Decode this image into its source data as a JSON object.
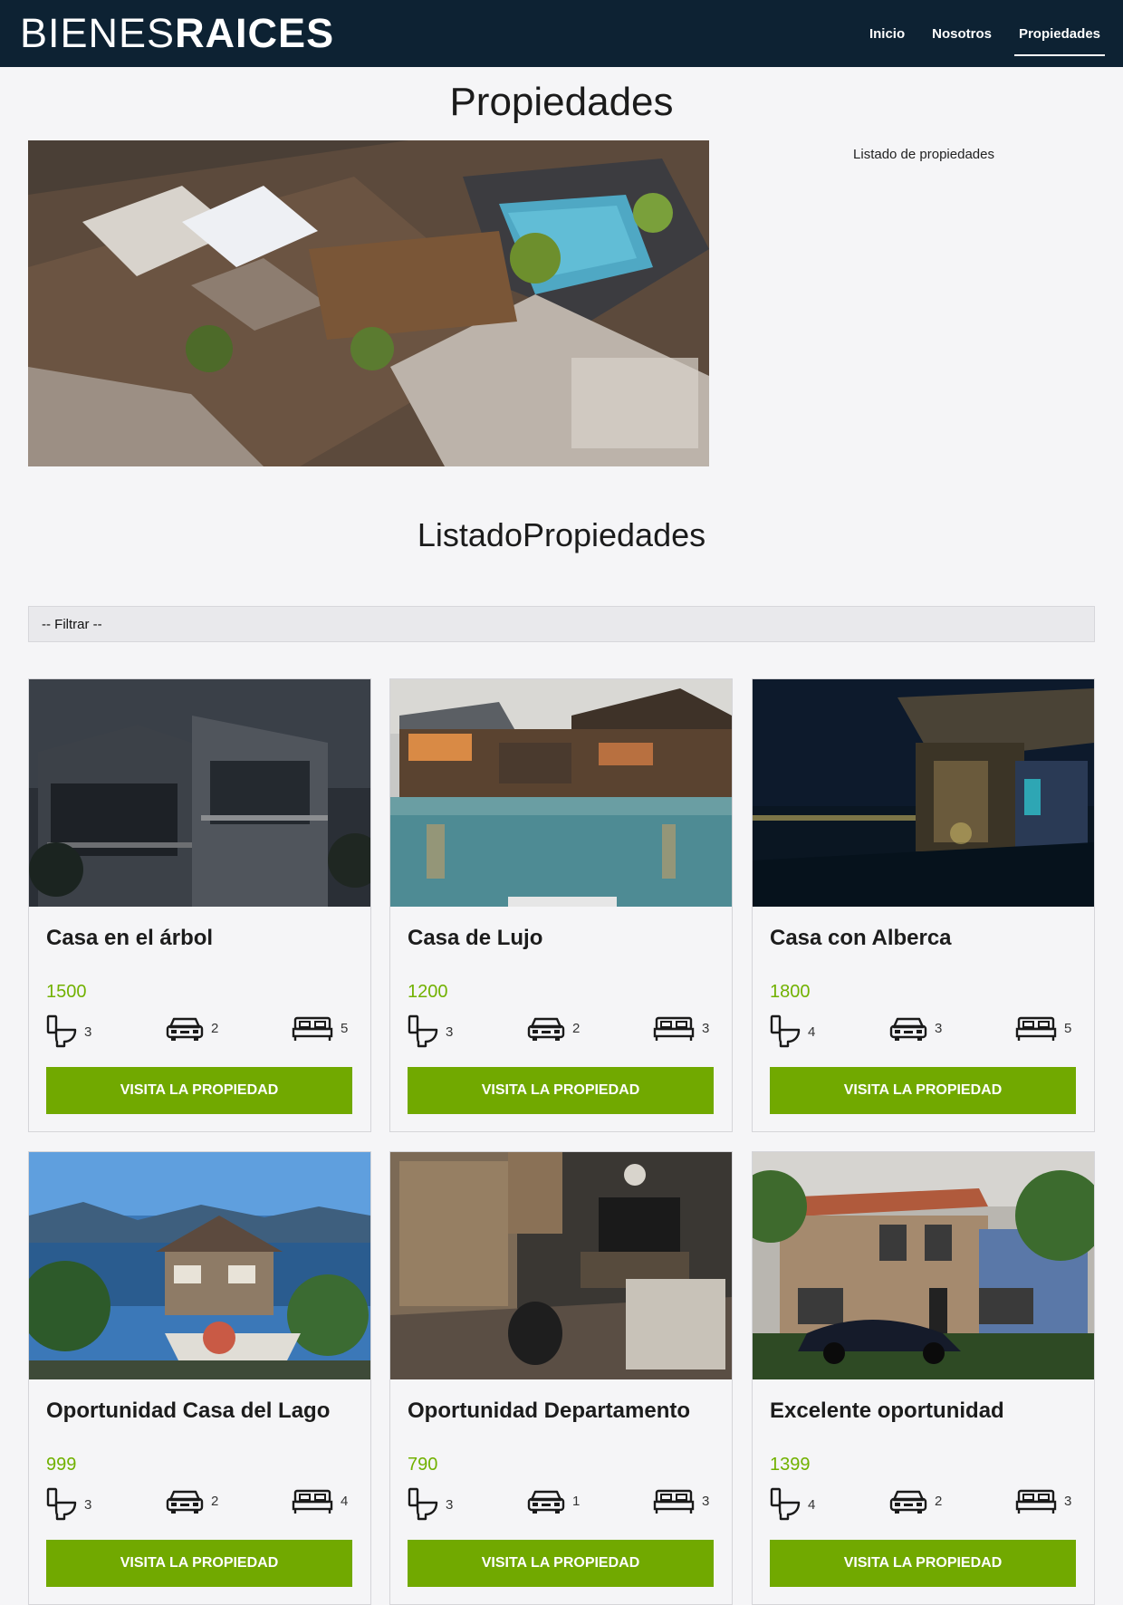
{
  "header": {
    "logo_thin": "BIENES",
    "logo_bold": "RAICES",
    "nav": [
      {
        "label": "Inicio"
      },
      {
        "label": "Nosotros"
      },
      {
        "label": "Propiedades"
      }
    ]
  },
  "page": {
    "title": "Propiedades",
    "hero_description": "Listado de propiedades"
  },
  "listing": {
    "title": "ListadoPropiedades",
    "filter_label": "-- Filtrar --",
    "button_label": "VISITA LA PROPIEDAD",
    "cards": [
      {
        "title": "Casa en el árbol",
        "price": "1500",
        "wc": "3",
        "parking": "2",
        "rooms": "5"
      },
      {
        "title": "Casa de Lujo",
        "price": "1200",
        "wc": "3",
        "parking": "2",
        "rooms": "3"
      },
      {
        "title": "Casa con Alberca",
        "price": "1800",
        "wc": "4",
        "parking": "3",
        "rooms": "5"
      },
      {
        "title": "Oportunidad Casa del Lago",
        "price": "999",
        "wc": "3",
        "parking": "2",
        "rooms": "4"
      },
      {
        "title": "Oportunidad Departamento",
        "price": "790",
        "wc": "3",
        "parking": "1",
        "rooms": "3"
      },
      {
        "title": "Excelente oportunidad",
        "price": "1399",
        "wc": "4",
        "parking": "2",
        "rooms": "3"
      }
    ]
  },
  "icons": {
    "wc": "toilet-icon",
    "parking": "car-icon",
    "rooms": "bed-icon"
  },
  "colors": {
    "header_bg": "#0d2233",
    "accent_green": "#71a900",
    "price_green": "#71b100"
  }
}
